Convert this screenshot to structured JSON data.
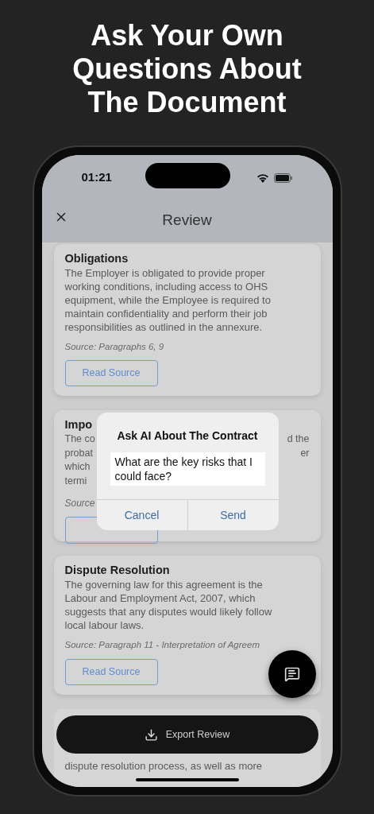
{
  "headline": "Ask Your Own Questions About The Document",
  "status_bar": {
    "time": "01:21"
  },
  "nav": {
    "title": "Review"
  },
  "cards": [
    {
      "kind": "full",
      "title": "Obligations",
      "body": "The Employer is obligated to provide proper working conditions, including access to OHS equipment, while the Employee is required to maintain confidentiality and perform their job responsibilities as outlined in the annexure.",
      "source": "Source: Paragraphs 6, 9",
      "button": "Read Source"
    },
    {
      "kind": "covered",
      "title": "Impo",
      "left_lines": [
        "The co",
        "probat",
        "which",
        "termi"
      ],
      "right_lines": [
        "d the",
        "er"
      ],
      "source": "Source"
    },
    {
      "kind": "full",
      "title": "Dispute Resolution",
      "body": "The governing law for this agreement is the Labour and Employment Act, 2007, which suggests that any disputes would likely follow local labour laws.",
      "source": "Source: Paragraph 11 - Interpretation of Agreem",
      "button": "Read Source"
    },
    {
      "kind": "tail",
      "body": "dispute resolution process, as well as more"
    }
  ],
  "dialog": {
    "title": "Ask AI About The Contract",
    "value": "What are the key risks that I could face?",
    "buttons": [
      "Cancel",
      "Send"
    ]
  },
  "export_button": "Export Review"
}
